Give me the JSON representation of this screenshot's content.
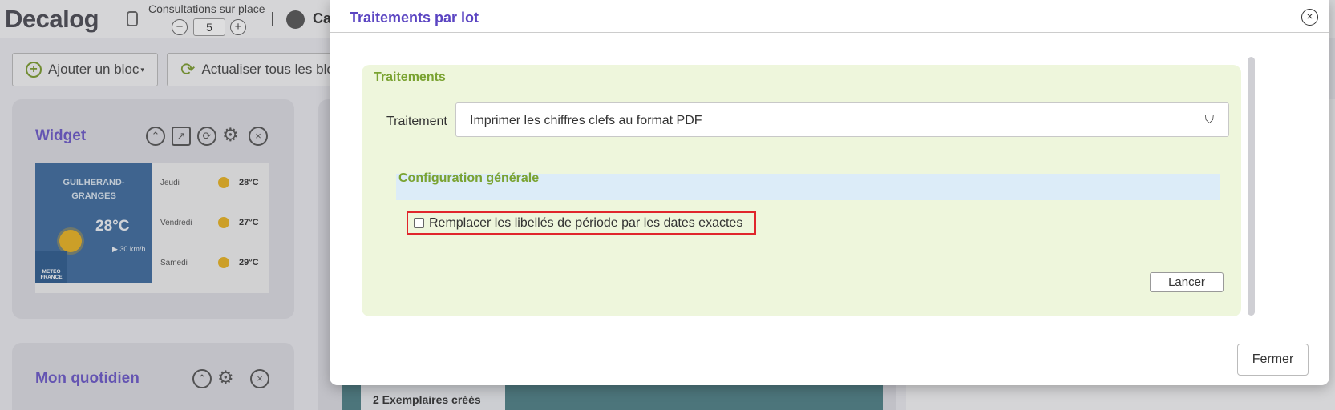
{
  "app": {
    "logo": "Decalog",
    "consultations_label": "Consultations sur place",
    "consultations_value": "5",
    "minus": "−",
    "plus": "+",
    "user_name": "Ca"
  },
  "toolbar": {
    "add_block_label": "Ajouter un bloc",
    "refresh_all_label": "Actualiser tous les blocs"
  },
  "widget_card": {
    "title": "Widget",
    "weather": {
      "city_line1": "GUILHERAND-",
      "city_line2": "GRANGES",
      "current_temp": "28°C",
      "wind": "30 km/h",
      "provider_line1": "METEO",
      "provider_line2": "FRANCE",
      "forecast": [
        {
          "day": "Jeudi",
          "temp": "28°C"
        },
        {
          "day": "Vendredi",
          "temp": "27°C"
        },
        {
          "day": "Samedi",
          "temp": "29°C"
        }
      ]
    }
  },
  "quotidien_card": {
    "title": "Mon quotidien"
  },
  "center": {
    "exemplaires_label": "2 Exemplaires créés"
  },
  "modal": {
    "title": "Traitements par lot",
    "section_title": "Traitements",
    "field_label": "Traitement",
    "selected_treatment": "Imprimer les chiffres clefs au format PDF",
    "config_title": "Configuration générale",
    "checkbox_label": "Remplacer les libellés de période par les dates exactes",
    "checkbox_checked": false,
    "launch_label": "Lancer",
    "close_label": "Fermer"
  },
  "colors": {
    "accent_purple": "#5b45c2",
    "section_green": "#7aa332",
    "panel_green_bg": "#eef6dc",
    "config_blue_bg": "#dcecf8",
    "highlight_red": "#e0262c"
  }
}
